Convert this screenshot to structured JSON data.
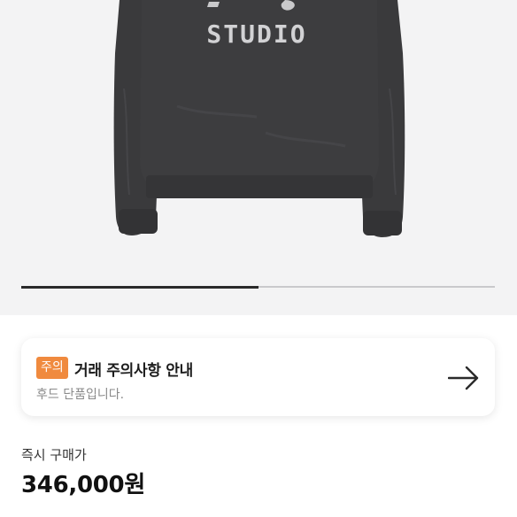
{
  "product_image": {
    "graphic_text": "STUDIO",
    "carousel_progress": 0.5
  },
  "notice": {
    "badge": "주의",
    "title": "거래 주의사항 안내",
    "subtitle": "후드 단품입니다."
  },
  "price": {
    "label": "즉시 구매가",
    "value": "346,000원"
  },
  "colors": {
    "badge": "#f08a3e",
    "hoodie": "#3b3b3d"
  },
  "icons": {
    "notice_link": "arrow-right-icon"
  }
}
